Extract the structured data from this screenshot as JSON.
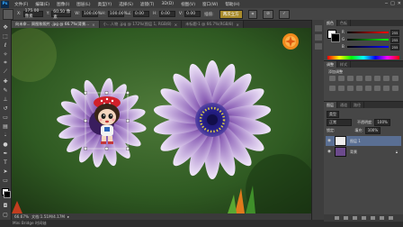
{
  "app": {
    "logo": "Ps"
  },
  "menu": [
    "文件(F)",
    "编辑(E)",
    "图像(I)",
    "图层(L)",
    "类型(Y)",
    "选择(S)",
    "滤镜(T)",
    "3D(D)",
    "视图(V)",
    "窗口(W)",
    "帮助(H)"
  ],
  "window_controls": {
    "minimize": "─",
    "maximize": "□",
    "close": "✕"
  },
  "options": {
    "x_label": "X:",
    "x_value": "175.00 像素",
    "y_label": "Y:",
    "y_value": "60.50 像素",
    "w_label": "W:",
    "w_value": "100.00%",
    "h_label": "H:",
    "h_value": "100.00%",
    "angle_value": "0.00",
    "h_skew": "0.00",
    "v_skew": "0.00",
    "interp_label": "插值:",
    "interp_value": "两次立方",
    "commit_icon": "✓",
    "cancel_icon": "⊘"
  },
  "tabs": [
    {
      "label": "向未命... 周图和照片 .jpg @ 66.7%(背景...",
      "active": true
    },
    {
      "label": "小...人物 .jpg @ 172%(图层 1, RGB/8)",
      "active": false
    },
    {
      "label": "未标题-1 @ 66.7%(RGB/8)",
      "active": false
    }
  ],
  "status": {
    "zoom": "66.67%",
    "doc": "文档:1.51M/4.17M"
  },
  "bottom": {
    "label": "Mini Bridge    时间轴"
  },
  "panels": {
    "color_tabs": [
      "颜色",
      "色板"
    ],
    "adj_tabs": [
      "调整",
      "样式"
    ],
    "adj_title": "添加调整",
    "layer_tabs": [
      "图层",
      "通道",
      "路径"
    ],
    "kind": "类型",
    "blend_mode": "正常",
    "opacity_label": "不透明度:",
    "opacity_value": "100%",
    "lock_label": "锁定:",
    "fill_label": "填充:",
    "fill_value": "100%",
    "color_r": "R",
    "color_g": "G",
    "color_b": "B",
    "r_val": "255",
    "g_val": "255",
    "b_val": "255"
  },
  "layers": [
    {
      "name": "图层 1",
      "selected": true
    },
    {
      "name": "背景",
      "selected": false
    }
  ],
  "colors": {
    "accent": "#5a6f93",
    "commit": "#a98b2b"
  }
}
